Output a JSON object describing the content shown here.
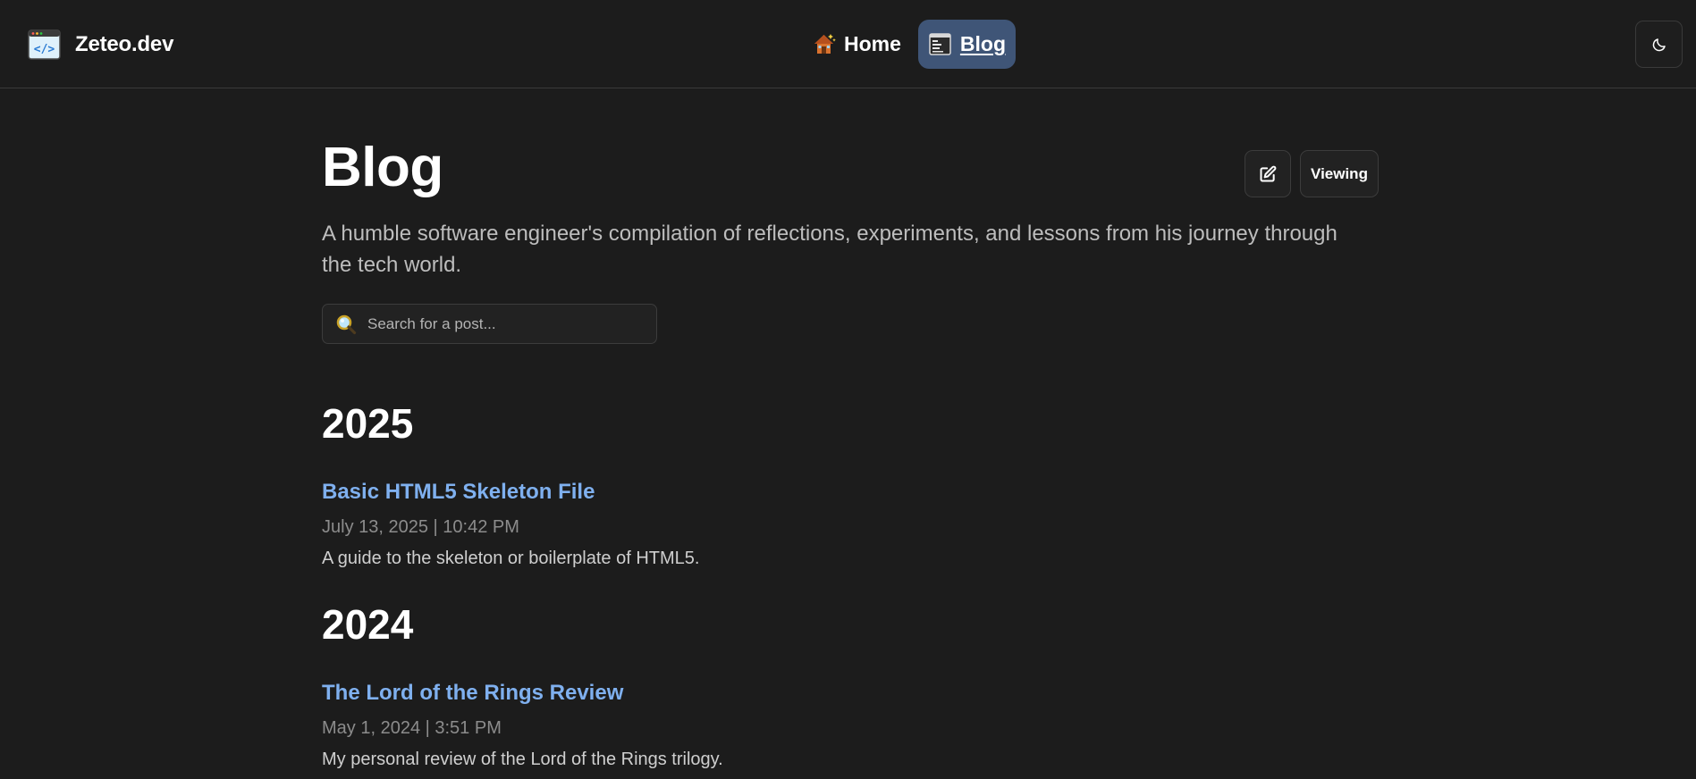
{
  "brand": {
    "name": "Zeteo.dev"
  },
  "nav": {
    "items": [
      {
        "label": "Home",
        "icon": "house-icon",
        "active": false
      },
      {
        "label": "Blog",
        "icon": "terminal-document-icon",
        "active": true
      }
    ]
  },
  "theme_toggle": {
    "icon": "moon-icon"
  },
  "page": {
    "title": "Blog",
    "subtitle": "A humble software engineer's compilation of reflections, experiments, and lessons from his journey through the tech world.",
    "actions": {
      "edit_icon": "edit-icon",
      "viewing_label": "Viewing"
    }
  },
  "search": {
    "placeholder": "Search for a post...",
    "value": ""
  },
  "sections": [
    {
      "year": "2025",
      "posts": [
        {
          "title": "Basic HTML5 Skeleton File",
          "date": "July 13, 2025 | 10:42 PM",
          "description": "A guide to the skeleton or boilerplate of HTML5."
        }
      ]
    },
    {
      "year": "2024",
      "posts": [
        {
          "title": "The Lord of the Rings Review",
          "date": "May 1, 2024 | 3:51 PM",
          "description": "My personal review of the Lord of the Rings trilogy."
        }
      ]
    }
  ],
  "colors": {
    "background": "#1c1c1c",
    "active_nav": "#3f5577",
    "link": "#7fb0ef",
    "date": "#8c8c8c"
  }
}
